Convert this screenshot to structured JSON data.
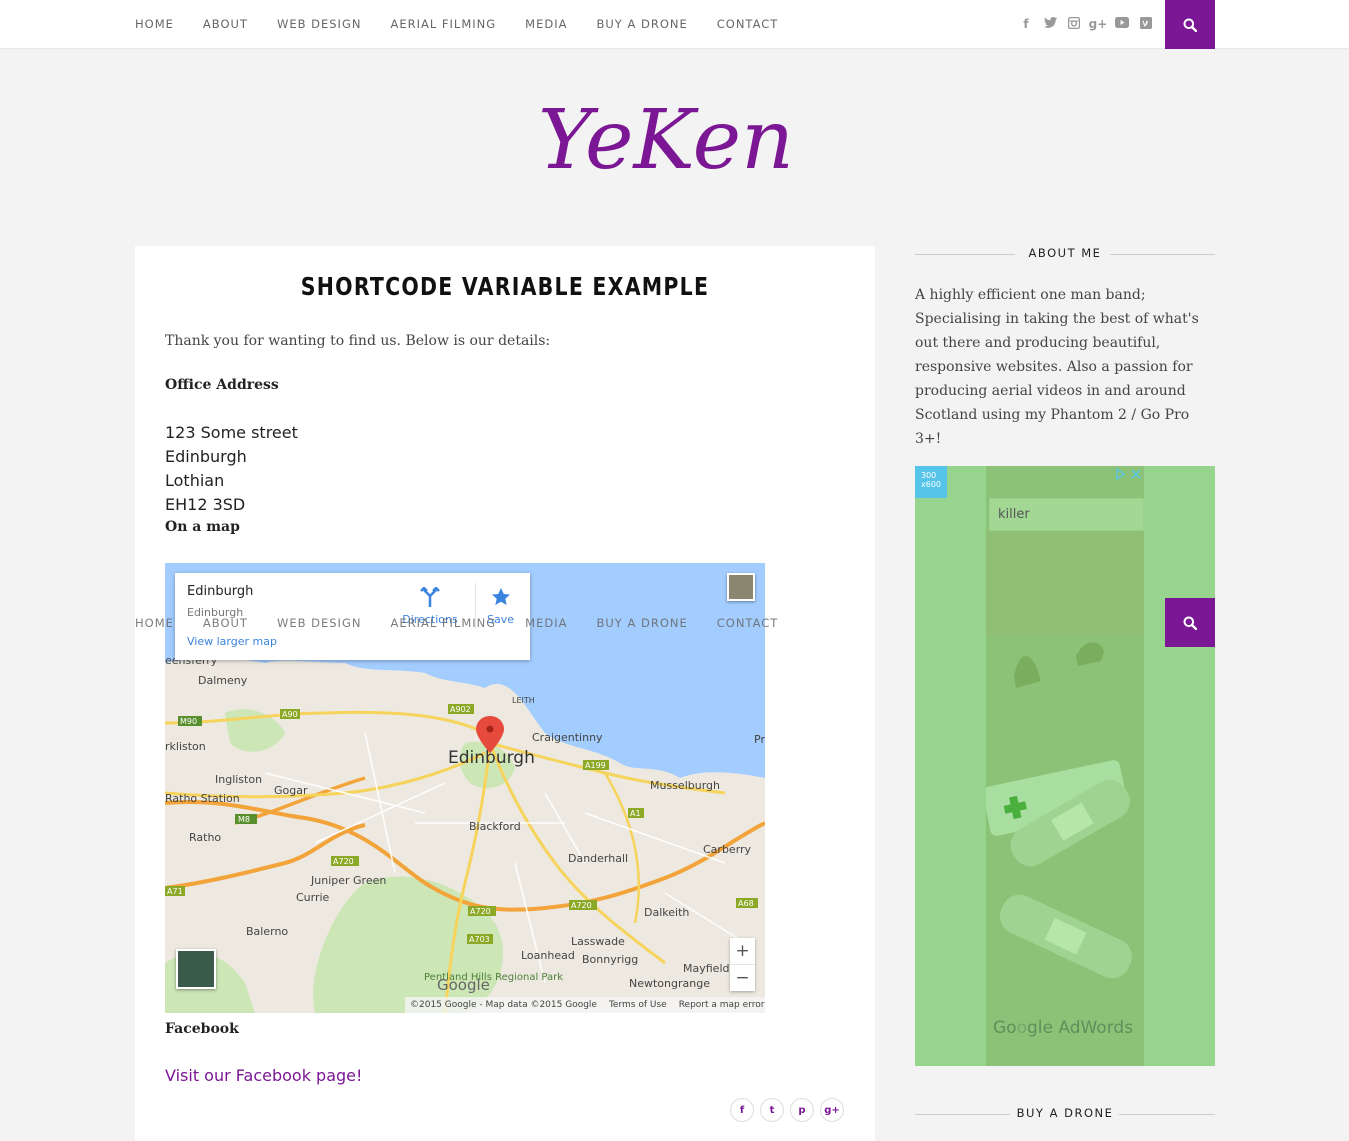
{
  "nav": {
    "items": [
      "HOME",
      "ABOUT",
      "WEB DESIGN",
      "AERIAL FILMING",
      "MEDIA",
      "BUY A DRONE",
      "CONTACT"
    ]
  },
  "social": {
    "icons": [
      "facebook-icon",
      "twitter-icon",
      "instagram-icon",
      "google-plus-icon",
      "youtube-icon",
      "vimeo-icon"
    ],
    "glyphs": [
      "f",
      "t",
      "◘",
      "g+",
      "▶",
      "v"
    ]
  },
  "logo": {
    "text": "YeKen",
    "color": "#7b1694"
  },
  "post": {
    "title": "SHORTCODE VARIABLE EXAMPLE",
    "intro": "Thank you for wanting to find us. Below is our details:",
    "office_label": "Office Address",
    "address": [
      "123 Some street",
      "Edinburgh",
      "Lothian",
      "EH12 3SD"
    ],
    "map_label": "On a map",
    "facebook_label": "Facebook",
    "facebook_link": "Visit our Facebook page!"
  },
  "map": {
    "info": {
      "title": "Edinburgh",
      "subtitle": "Edinburgh",
      "link": "View larger map",
      "directions": "Directions",
      "save": "Save"
    },
    "places": [
      "Dalmeny",
      "rkliston",
      "Ingliston",
      "Ratho Station",
      "Gogar",
      "Ratho",
      "Edinburgh",
      "Craigentinny",
      "Musselburgh",
      "Blackford",
      "Danderhall",
      "Carberry",
      "Juniper Green",
      "Currie",
      "Dalkeith",
      "Balerno",
      "Lasswade",
      "Loanhead",
      "Bonnyrigg",
      "Mayfield",
      "Newtongrange",
      "Pentland Hills Regional Park",
      "LEITH",
      "eensferry",
      "Pr"
    ],
    "roads": [
      "M90",
      "A90",
      "A902",
      "A199",
      "A1",
      "M8",
      "A720",
      "A71",
      "A720",
      "A720",
      "A703",
      "A68"
    ],
    "attribution": [
      "©2015 Google - Map data ©2015 Google",
      "Terms of Use",
      "Report a map error"
    ],
    "google": "Google",
    "zoom_in": "+",
    "zoom_out": "−"
  },
  "share": [
    "f",
    "t",
    "p",
    "g+"
  ],
  "sidebar": {
    "about_title": "ABOUT ME",
    "about_text": "A highly efficient one man band; Specialising in taking the best of what's out there and producing beautiful, responsive websites. Also a passion for producing aerial videos in and around Scotland using my Phantom 2 / Go Pro 3+!",
    "ad": {
      "size_label": "300 x600",
      "search_value": "killer",
      "brand": "AdWords"
    },
    "buy_title": "BUY A DRONE"
  }
}
